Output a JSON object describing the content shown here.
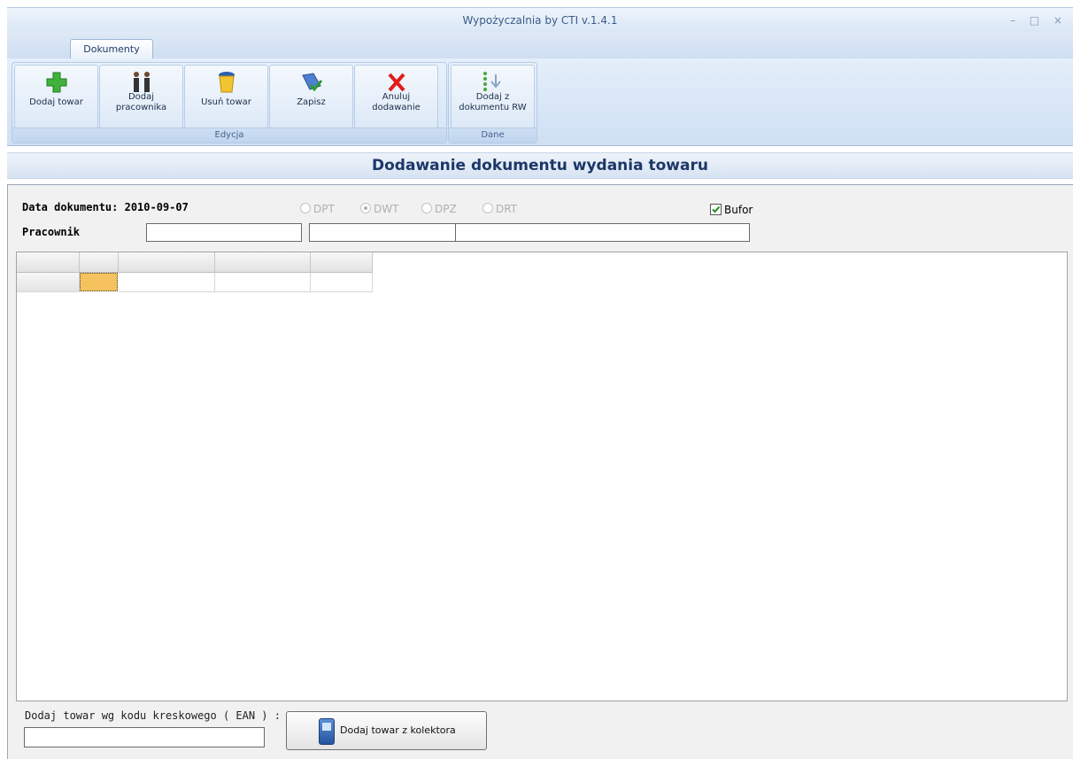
{
  "window": {
    "title": "Wypożyczalnia by CTI v.1.4.1",
    "controls": "– □ ×"
  },
  "ribbon": {
    "tab": "Dokumenty",
    "groups": [
      {
        "label": "Edycja",
        "buttons": [
          {
            "label": "Dodaj towar",
            "icon": "plus-icon"
          },
          {
            "label": "Dodaj pracownika",
            "icon": "people-icon"
          },
          {
            "label": "Usuń towar",
            "icon": "trash-icon"
          },
          {
            "label": "Zapisz",
            "icon": "save-icon"
          },
          {
            "label": "Anuluj dodawanie",
            "icon": "cancel-icon"
          }
        ]
      },
      {
        "label": "Dane",
        "buttons": [
          {
            "label": "Dodaj z dokumentu RW",
            "icon": "import-list-icon"
          }
        ]
      }
    ]
  },
  "header": {
    "title": "Dodawanie dokumentu wydania towaru"
  },
  "form": {
    "date_label": "Data dokumentu: 2010-09-07",
    "employee_label": "Pracownik",
    "doc_types": [
      {
        "label": "DPT",
        "checked": false
      },
      {
        "label": "DWT",
        "checked": true
      },
      {
        "label": "DPZ",
        "checked": false
      },
      {
        "label": "DRT",
        "checked": false
      }
    ],
    "bufor_label": "Bufor",
    "bufor_checked": true,
    "employee_fields": [
      "",
      "",
      ""
    ]
  },
  "grid": {
    "headers": [
      "",
      "",
      "",
      "",
      ""
    ],
    "rows": [
      [
        "",
        "",
        "",
        "",
        ""
      ]
    ]
  },
  "bottom": {
    "ean_label": "Dodaj towar wg kodu kreskowego ( EAN ) :",
    "ean_value": "",
    "collector_button": "Dodaj towar z kolektora"
  },
  "colors": {
    "accent": "#1c3768",
    "selected_cell": "#f5c25e"
  }
}
